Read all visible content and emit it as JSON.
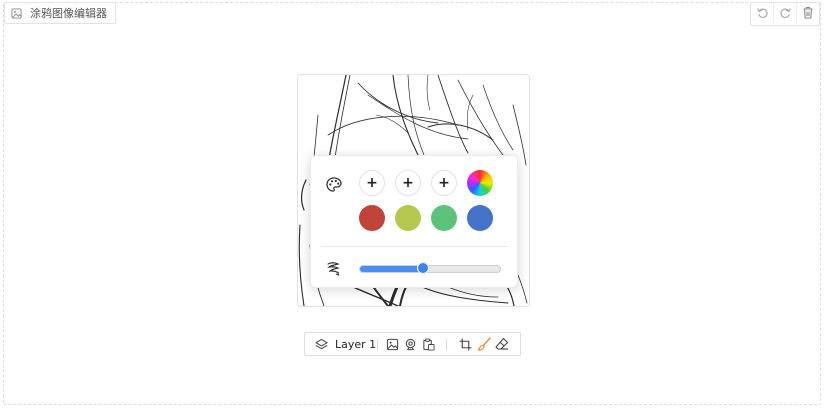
{
  "app": {
    "title": "涂鸦图像编辑器",
    "title_icon": "image-icon"
  },
  "history": {
    "undo_icon": "undo-icon",
    "redo_icon": "redo-icon",
    "delete_icon": "trash-icon"
  },
  "brush_popup": {
    "palette_icon": "palette-icon",
    "add_label": "+",
    "color_picker_icon": "color-wheel-icon",
    "preset_colors": [
      "#c0443a",
      "#b5c84d",
      "#5ec37a",
      "#4473c9"
    ],
    "brush_size_icon": "brush-size-icon",
    "brush_size_fraction": 0.45
  },
  "toolbar": {
    "layer_label": "Layer 1",
    "icons": [
      "layers-icon",
      "image-icon",
      "webcam-icon",
      "paste-icon",
      "crop-icon",
      "brush-icon",
      "eraser-icon"
    ],
    "active_tool_color": "#f08a3c"
  }
}
